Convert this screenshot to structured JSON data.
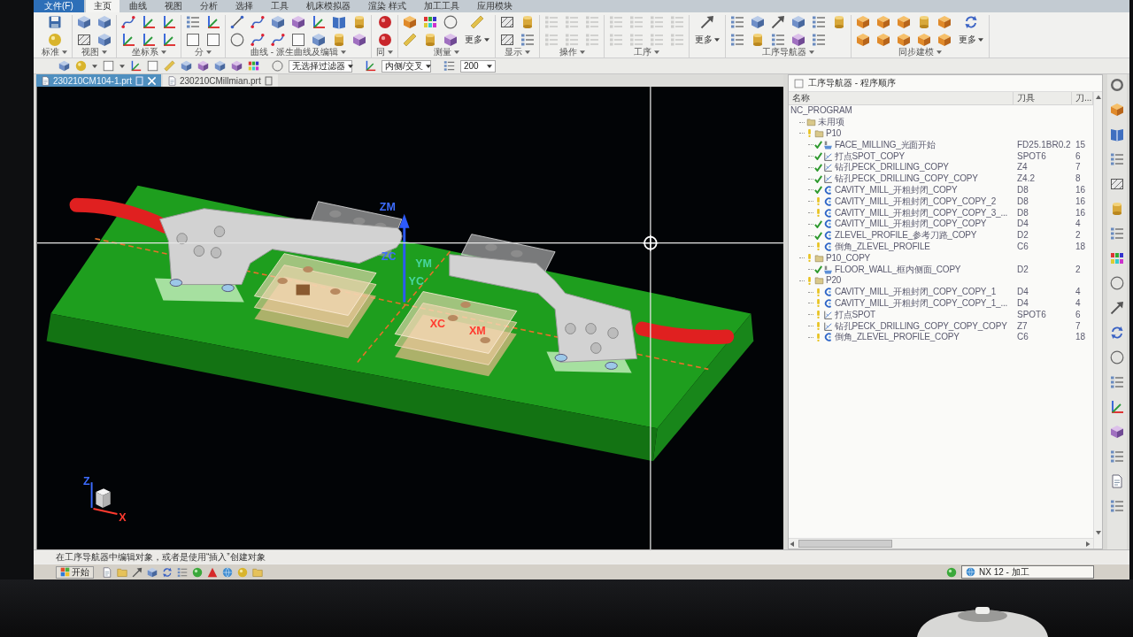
{
  "menu_tabs": [
    {
      "label": "文件(F)",
      "kind": "file",
      "selected": false
    },
    {
      "label": "主页",
      "kind": "tab",
      "selected": true
    },
    {
      "label": "曲线",
      "kind": "tab",
      "selected": false
    },
    {
      "label": "视图",
      "kind": "tab",
      "selected": false
    },
    {
      "label": "分析",
      "kind": "tab",
      "selected": false
    },
    {
      "label": "选择",
      "kind": "tab",
      "selected": false
    },
    {
      "label": "工具",
      "kind": "tab",
      "selected": false
    },
    {
      "label": "机床模拟器",
      "kind": "tab",
      "selected": false
    },
    {
      "label": "渲染 样式",
      "kind": "tab",
      "selected": false
    },
    {
      "label": "加工工具",
      "kind": "tab",
      "selected": false
    },
    {
      "label": "应用模块",
      "kind": "tab",
      "selected": false
    }
  ],
  "ribbon": {
    "groups": [
      {
        "label": "标准",
        "disabled": false
      },
      {
        "label": "视图",
        "disabled": false
      },
      {
        "label": "坐标系",
        "disabled": false
      },
      {
        "label": "分",
        "disabled": false
      },
      {
        "label": "曲线 - 派生曲线及编辑",
        "disabled": false
      },
      {
        "label": "同",
        "disabled": false
      },
      {
        "label": "测量",
        "more": "更多",
        "disabled": false
      },
      {
        "label": "显示",
        "disabled": false
      },
      {
        "label": "操作",
        "disabled": true
      },
      {
        "label": "工序",
        "disabled": true
      },
      {
        "more": "更多",
        "disabled": false
      },
      {
        "label": "工序导航器",
        "disabled": false
      },
      {
        "label": "同步建模",
        "more": "更多",
        "disabled": false
      }
    ]
  },
  "quick_toolbar": {
    "dropdowns": [
      {
        "value": "无选择过滤器"
      },
      {
        "value": "内侧/交叉"
      },
      {
        "value": "200"
      }
    ]
  },
  "doc_tabs": [
    {
      "label": "230210CM104-1.prt",
      "selected": true
    },
    {
      "label": "230210CMillmian.prt",
      "selected": false
    }
  ],
  "viewport": {
    "axis_labels": [
      {
        "text": "ZM",
        "color": "#3d6cff"
      },
      {
        "text": "ZC",
        "color": "#3d6cff"
      },
      {
        "text": "YM",
        "color": "#48d6a0"
      },
      {
        "text": "YC",
        "color": "#48d6a0"
      },
      {
        "text": "XC",
        "color": "#ff3b2f"
      },
      {
        "text": "XM",
        "color": "#ff3b2f"
      }
    ],
    "triad_labels": [
      {
        "text": "Z",
        "color": "#3d6cff"
      },
      {
        "text": "X",
        "color": "#ff3b2f"
      }
    ]
  },
  "navigator": {
    "title": "工序导航器 - 程序顺序",
    "columns": [
      "名称",
      "刀具",
      "刀..."
    ],
    "tree": [
      {
        "name": "NC_PROGRAM",
        "children": [
          {
            "name": "未用项",
            "kind": "group"
          },
          {
            "name": "P10",
            "kind": "group",
            "complete": false,
            "children": [
              {
                "name": "FACE_MILLING_光面开始",
                "kind": "face_mill",
                "complete": true,
                "tool": "FD25.1BR0.2",
                "column_3": "15"
              },
              {
                "name": "打点SPOT_COPY",
                "kind": "drill",
                "complete": true,
                "tool": "SPOT6",
                "column_3": "6"
              },
              {
                "name": "钻孔PECK_DRILLING_COPY",
                "kind": "drill",
                "complete": true,
                "tool": "Z4",
                "column_3": "7"
              },
              {
                "name": "钻孔PECK_DRILLING_COPY_COPY",
                "kind": "drill",
                "complete": true,
                "tool": "Z4.2",
                "column_3": "8"
              },
              {
                "name": "CAVITY_MILL_开粗封闭_COPY",
                "kind": "cavity_mill",
                "complete": true,
                "tool": "D8",
                "column_3": "16"
              },
              {
                "name": "CAVITY_MILL_开粗封闭_COPY_COPY_2",
                "kind": "cavity_mill",
                "complete": false,
                "tool": "D8",
                "column_3": "16"
              },
              {
                "name": "CAVITY_MILL_开粗封闭_COPY_COPY_3_...",
                "kind": "cavity_mill",
                "complete": false,
                "tool": "D8",
                "column_3": "16"
              },
              {
                "name": "CAVITY_MILL_开粗封闭_COPY_COPY",
                "kind": "cavity_mill",
                "complete": true,
                "tool": "D4",
                "column_3": "4"
              },
              {
                "name": "ZLEVEL_PROFILE_参考刀路_COPY",
                "kind": "cavity_mill",
                "complete": true,
                "tool": "D2",
                "column_3": "2"
              },
              {
                "name": "倒角_ZLEVEL_PROFILE",
                "kind": "cavity_mill",
                "complete": false,
                "tool": "C6",
                "column_3": "18"
              }
            ]
          },
          {
            "name": "P10_COPY",
            "kind": "group",
            "complete": false,
            "children": [
              {
                "name": "FLOOR_WALL_框内侧面_COPY",
                "kind": "face_mill",
                "complete": true,
                "tool": "D2",
                "column_3": "2"
              }
            ]
          },
          {
            "name": "P20",
            "kind": "group",
            "complete": false,
            "children": [
              {
                "name": "CAVITY_MILL_开粗封闭_COPY_COPY_1",
                "kind": "cavity_mill",
                "complete": false,
                "tool": "D4",
                "column_3": "4"
              },
              {
                "name": "CAVITY_MILL_开粗封闭_COPY_COPY_1_...",
                "kind": "cavity_mill",
                "complete": false,
                "tool": "D4",
                "column_3": "4"
              },
              {
                "name": "打点SPOT",
                "kind": "drill",
                "complete": false,
                "tool": "SPOT6",
                "column_3": "6"
              },
              {
                "name": "钻孔PECK_DRILLING_COPY_COPY_COPY",
                "kind": "drill",
                "complete": false,
                "tool": "Z7",
                "column_3": "7"
              },
              {
                "name": "倒角_ZLEVEL_PROFILE_COPY",
                "kind": "cavity_mill",
                "complete": false,
                "tool": "C6",
                "column_3": "18"
              }
            ]
          }
        ]
      }
    ]
  },
  "status_bar": {
    "message": "在工序导航器中编辑对象，或者是使用“插入”创建对象"
  },
  "taskbar": {
    "start_label": "开始",
    "task": {
      "label": "NX 12 - 加工",
      "selected": true
    }
  }
}
